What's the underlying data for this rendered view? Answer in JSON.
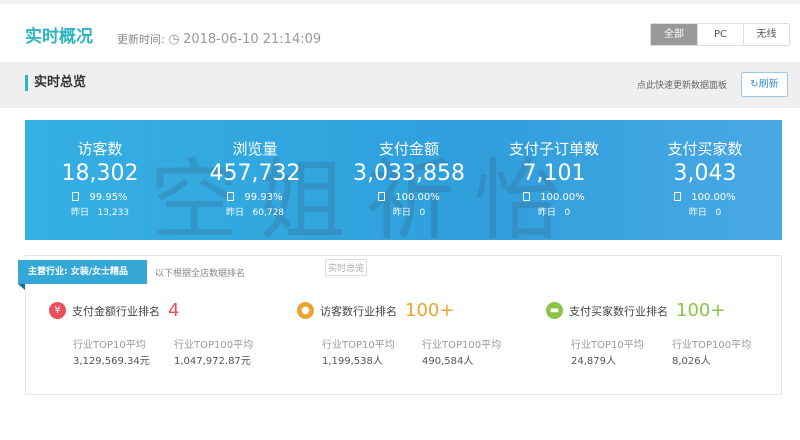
{
  "header": {
    "title": "实时概况",
    "update_label": "更新时间:",
    "update_time": "2018-06-10 21:14:09",
    "tabs": [
      "全部",
      "PC",
      "无线"
    ],
    "active_tab": "全部"
  },
  "section": {
    "title": "实时总览",
    "hint": "点此快速更新数据面板",
    "refresh_label": "刷新"
  },
  "watermark": "空姐祈怡",
  "kpis": [
    {
      "label": "访客数",
      "value": "18,302",
      "pct": "99.95%",
      "yest_label": "昨日",
      "yest": "13,233"
    },
    {
      "label": "浏览量",
      "value": "457,732",
      "pct": "99.93%",
      "yest_label": "昨日",
      "yest": "60,728"
    },
    {
      "label": "支付金额",
      "value": "3,033,858",
      "pct": "100.00%",
      "yest_label": "昨日",
      "yest": "0"
    },
    {
      "label": "支付子订单数",
      "value": "7,101",
      "pct": "100.00%",
      "yest_label": "昨日",
      "yest": "0"
    },
    {
      "label": "支付买家数",
      "value": "3,043",
      "pct": "100.00%",
      "yest_label": "昨日",
      "yest": "0"
    }
  ],
  "industry": {
    "badge": "主营行业: 女装/女士精品",
    "subtitle": "以下根据全店数据排名",
    "stamp": "实时总览",
    "ranks": [
      {
        "icon": "¥",
        "name": "支付金额行业排名",
        "rank": "4",
        "color": "#e8505b",
        "top10_label": "行业TOP10平均",
        "top10": "3,129,569.34元",
        "top100_label": "行业TOP100平均",
        "top100": "1,047,972.87元"
      },
      {
        "icon": "●",
        "name": "访客数行业排名",
        "rank": "100+",
        "color": "#f0a22e",
        "top10_label": "行业TOP10平均",
        "top10": "1,199,538人",
        "top100_label": "行业TOP100平均",
        "top100": "490,584人"
      },
      {
        "icon": "▬",
        "name": "支付买家数行业排名",
        "rank": "100+",
        "color": "#8bc34a",
        "top10_label": "行业TOP10平均",
        "top10": "24,879人",
        "top100_label": "行业TOP100平均",
        "top100": "8,026人"
      }
    ]
  }
}
